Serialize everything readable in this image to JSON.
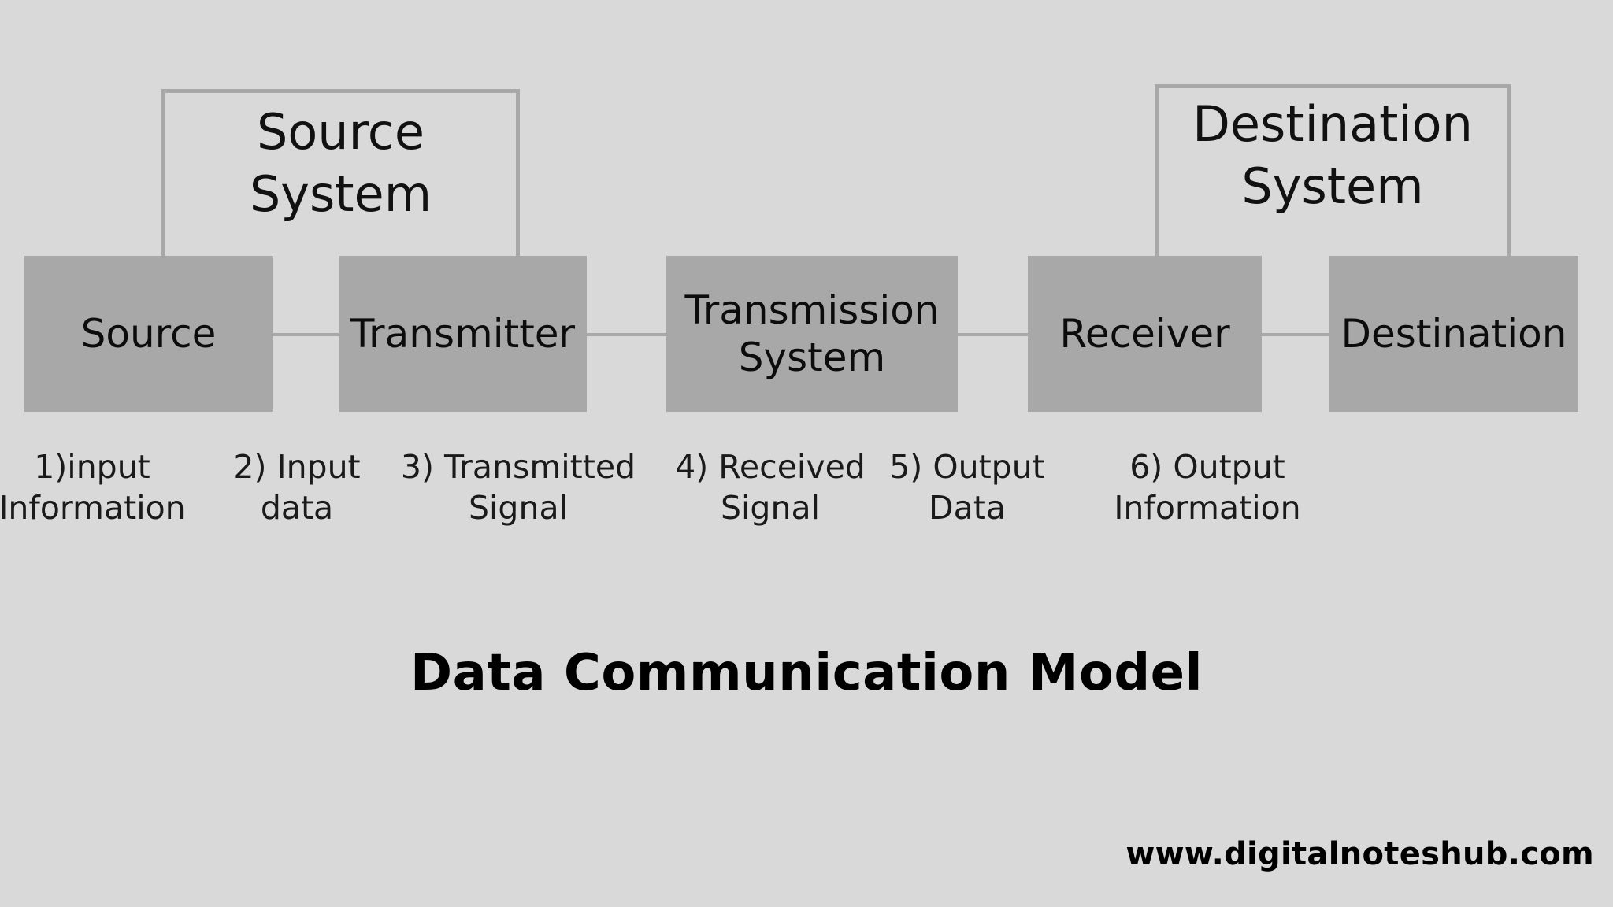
{
  "diagram": {
    "title": "Data Communication Model",
    "footer_url": "www.digitalnoteshub.com",
    "background_color": "#d9d9d9",
    "box_color": "#a8a8a8",
    "bracket_color": "#a8a8a8",
    "text_color": "#111111"
  },
  "groups": [
    {
      "id": "source-system",
      "label": "Source\nSystem"
    },
    {
      "id": "destination-system",
      "label": "Destination\nSystem"
    }
  ],
  "blocks": [
    {
      "id": "source",
      "label": "Source"
    },
    {
      "id": "transmitter",
      "label": "Transmitter"
    },
    {
      "id": "transmission-system",
      "label": "Transmission\nSystem"
    },
    {
      "id": "receiver",
      "label": "Receiver"
    },
    {
      "id": "destination",
      "label": "Destination"
    }
  ],
  "steps": [
    {
      "number": "1)",
      "label": "1)input\nInformation"
    },
    {
      "number": "2)",
      "label": "2) Input\ndata"
    },
    {
      "number": "3)",
      "label": "3) Transmitted\nSignal"
    },
    {
      "number": "4)",
      "label": "4) Received\nSignal"
    },
    {
      "number": "5)",
      "label": "5) Output\nData"
    },
    {
      "number": "6)",
      "label": "6) Output\nInformation"
    }
  ]
}
